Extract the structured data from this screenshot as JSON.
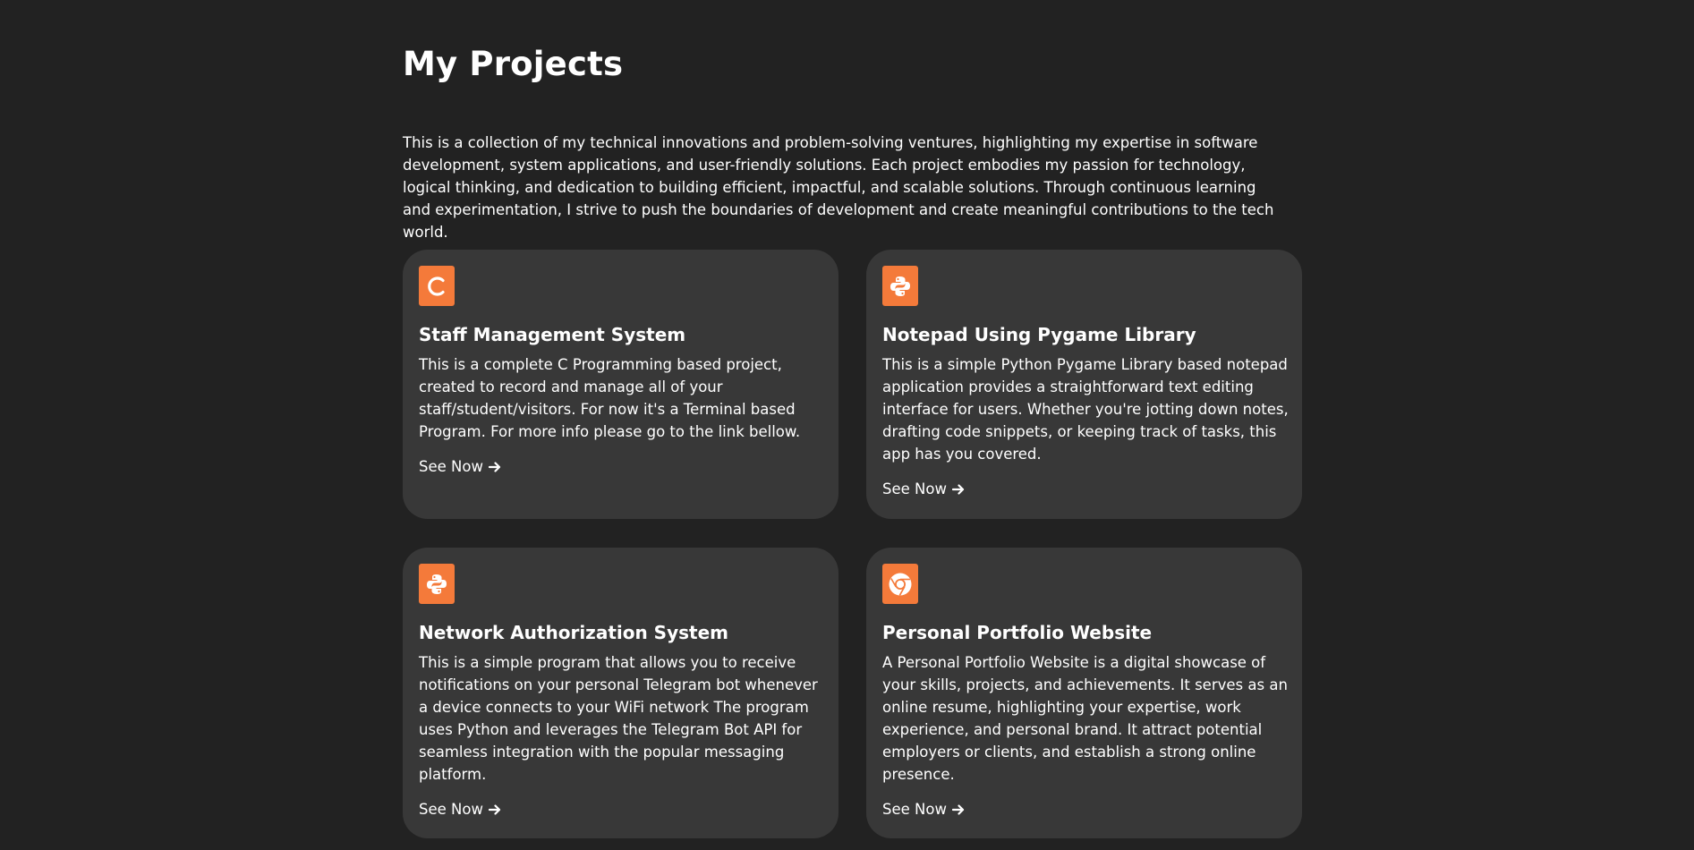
{
  "page": {
    "title": "My Projects",
    "intro": "This is a collection of my technical innovations and problem-solving ventures, highlighting my expertise in software development, system applications, and user-friendly solutions. Each project embodies my passion for technology, logical thinking, and dedication to building efficient, impactful, and scalable solutions. Through continuous learning and experimentation, I strive to push the boundaries of development and create meaningful contributions to the tech world."
  },
  "colors": {
    "background": "#222222",
    "card": "#383838",
    "accent": "#f47a3a",
    "text": "#ffffff"
  },
  "projects": [
    {
      "icon": "c-language-icon",
      "title": "Staff Management System",
      "description": "This is a complete C Programming based project, created to record and manage all of your staff/student/visitors. For now it's a Terminal based Program. For more info please go to the link bellow.",
      "link_label": "See Now"
    },
    {
      "icon": "python-icon",
      "title": "Notepad Using Pygame Library",
      "description": "This is a simple Python Pygame Library based notepad application provides a straightforward text editing interface for users. Whether you're jotting down notes, drafting code snippets, or keeping track of tasks, this app has you covered.",
      "link_label": "See Now"
    },
    {
      "icon": "python-icon",
      "title": "Network Authorization System",
      "description": "This is a simple program that allows you to receive notifications on your personal Telegram bot whenever a device connects to your WiFi network The program uses Python and leverages the Telegram Bot API for seamless integration with the popular messaging platform.",
      "link_label": "See Now"
    },
    {
      "icon": "chrome-icon",
      "title": "Personal Portfolio Website",
      "description": "A Personal Portfolio Website is a digital showcase of your skills, projects, and achievements. It serves as an online resume, highlighting your expertise, work experience, and personal brand. It attract potential employers or clients, and establish a strong online presence.",
      "link_label": "See Now"
    }
  ]
}
